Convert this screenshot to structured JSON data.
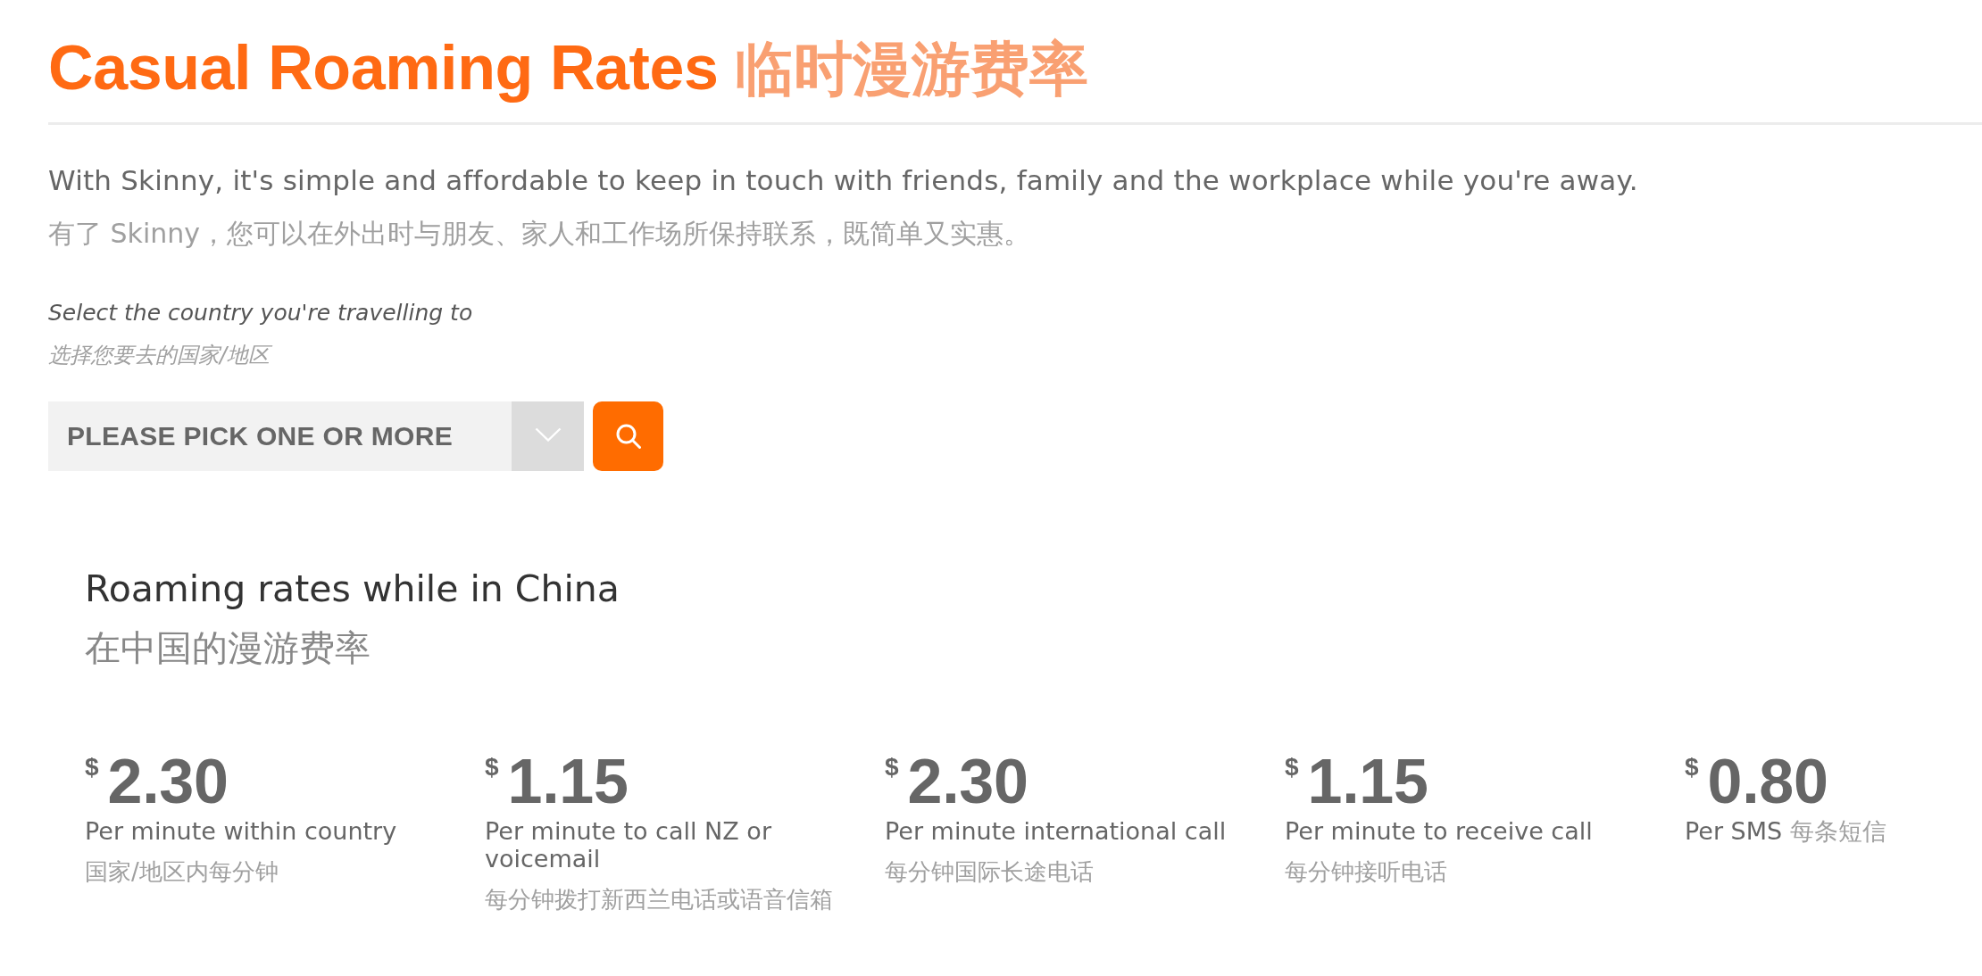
{
  "title": {
    "text": "Casual Roaming Rates",
    "text_zh": "临时漫游费率"
  },
  "intro": {
    "text": "With Skinny, it's simple and affordable to keep in touch with friends, family and the workplace while you're away.",
    "text_zh": "有了 Skinny，您可以在外出时与朋友、家人和工作场所保持联系，既简单又实惠。"
  },
  "country_picker": {
    "label": "Select the country you're travelling to",
    "label_zh": "选择您要去的国家/地区",
    "placeholder": "PLEASE PICK ONE OR MORE"
  },
  "rates_panel": {
    "heading": "Roaming rates while in China",
    "heading_zh": "在中国的漫游费率",
    "rates": [
      {
        "kind": "stacked",
        "currency": "$",
        "amount": "2.30",
        "label": "Per minute within country",
        "label_zh": "国家/地区内每分钟"
      },
      {
        "kind": "stacked",
        "currency": "$",
        "amount": "1.15",
        "label": "Per minute to call NZ or voicemail",
        "label_zh": "每分钟拨打新西兰电话或语音信箱"
      },
      {
        "kind": "stacked",
        "currency": "$",
        "amount": "2.30",
        "label": "Per minute international call",
        "label_zh": "每分钟国际长途电话"
      },
      {
        "kind": "stacked",
        "currency": "$",
        "amount": "1.15",
        "label": "Per minute to receive call",
        "label_zh": "每分钟接听电话"
      },
      {
        "kind": "inline",
        "currency": "$",
        "amount": "0.80",
        "label": "Per SMS",
        "label_zh": "每条短信"
      }
    ]
  }
}
